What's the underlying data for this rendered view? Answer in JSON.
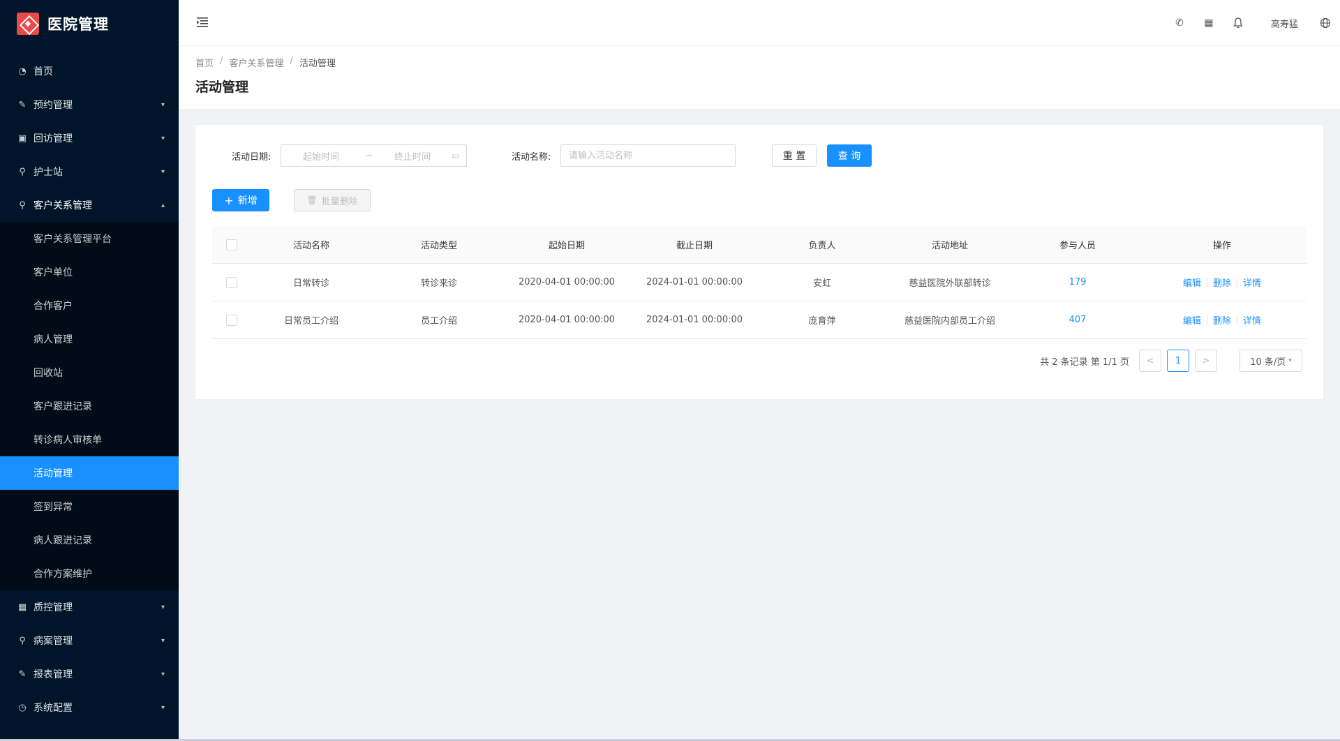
{
  "app": {
    "title": "医院管理"
  },
  "sidebar": {
    "items": [
      {
        "label": "首页",
        "icon": "dashboard-icon",
        "arrow": ""
      },
      {
        "label": "预约管理",
        "icon": "edit-icon",
        "arrow": "⌄"
      },
      {
        "label": "回访管理",
        "icon": "lock-icon",
        "arrow": "⌄"
      },
      {
        "label": "护士站",
        "icon": "user-icon",
        "arrow": "⌄"
      },
      {
        "label": "客户关系管理",
        "icon": "user-icon",
        "arrow": "⌃"
      }
    ],
    "subitems": [
      {
        "label": "客户关系管理平台"
      },
      {
        "label": "客户单位"
      },
      {
        "label": "合作客户"
      },
      {
        "label": "病人管理"
      },
      {
        "label": "回收站"
      },
      {
        "label": "客户跟进记录"
      },
      {
        "label": "转诊病人审核单"
      },
      {
        "label": "活动管理"
      },
      {
        "label": "签到异常"
      },
      {
        "label": "病人跟进记录"
      },
      {
        "label": "合作方案维护"
      }
    ],
    "bottom_items": [
      {
        "label": "质控管理",
        "icon": "table-icon",
        "arrow": "⌄"
      },
      {
        "label": "病案管理",
        "icon": "user-icon",
        "arrow": "⌄"
      },
      {
        "label": "报表管理",
        "icon": "edit-icon",
        "arrow": "⌄"
      },
      {
        "label": "系统配置",
        "icon": "gauge-icon",
        "arrow": "⌄"
      }
    ]
  },
  "header": {
    "username": "高寿猛",
    "icons": [
      "phone-icon",
      "apps-icon",
      "bell-icon",
      "globe-icon"
    ]
  },
  "breadcrumb": {
    "items": [
      "首页",
      "客户关系管理",
      "活动管理"
    ],
    "sep": "/"
  },
  "page": {
    "title": "活动管理"
  },
  "filters": {
    "date_label": "活动日期:",
    "start_placeholder": "起始时间",
    "range_sep": "~",
    "end_placeholder": "终止时间",
    "name_label": "活动名称:",
    "name_placeholder": "请输入活动名称",
    "reset": "重 置",
    "query": "查 询"
  },
  "actions": {
    "add": "新增",
    "batch_delete": "批量删除"
  },
  "table": {
    "headers": [
      "活动名称",
      "活动类型",
      "起始日期",
      "截止日期",
      "负责人",
      "活动地址",
      "参与人员",
      "操作"
    ],
    "rows": [
      {
        "name": "日常转诊",
        "type": "转诊来诊",
        "start": "2020-04-01 00:00:00",
        "end": "2024-01-01 00:00:00",
        "owner": "安虹",
        "address": "慈益医院外联部转诊",
        "count": "179"
      },
      {
        "name": "日常员工介绍",
        "type": "员工介绍",
        "start": "2020-04-01 00:00:00",
        "end": "2024-01-01 00:00:00",
        "owner": "庞育萍",
        "address": "慈益医院内部员工介绍",
        "count": "407"
      }
    ],
    "ops": {
      "edit": "编辑",
      "delete": "删除",
      "detail": "详情"
    }
  },
  "pagination": {
    "total_text": "共 2 条记录 第 1/1 页",
    "current": "1",
    "prev": "<",
    "next": ">",
    "page_size": "10 条/页"
  },
  "colors": {
    "sidebar_bg": "#001529",
    "primary": "#1890ff"
  }
}
